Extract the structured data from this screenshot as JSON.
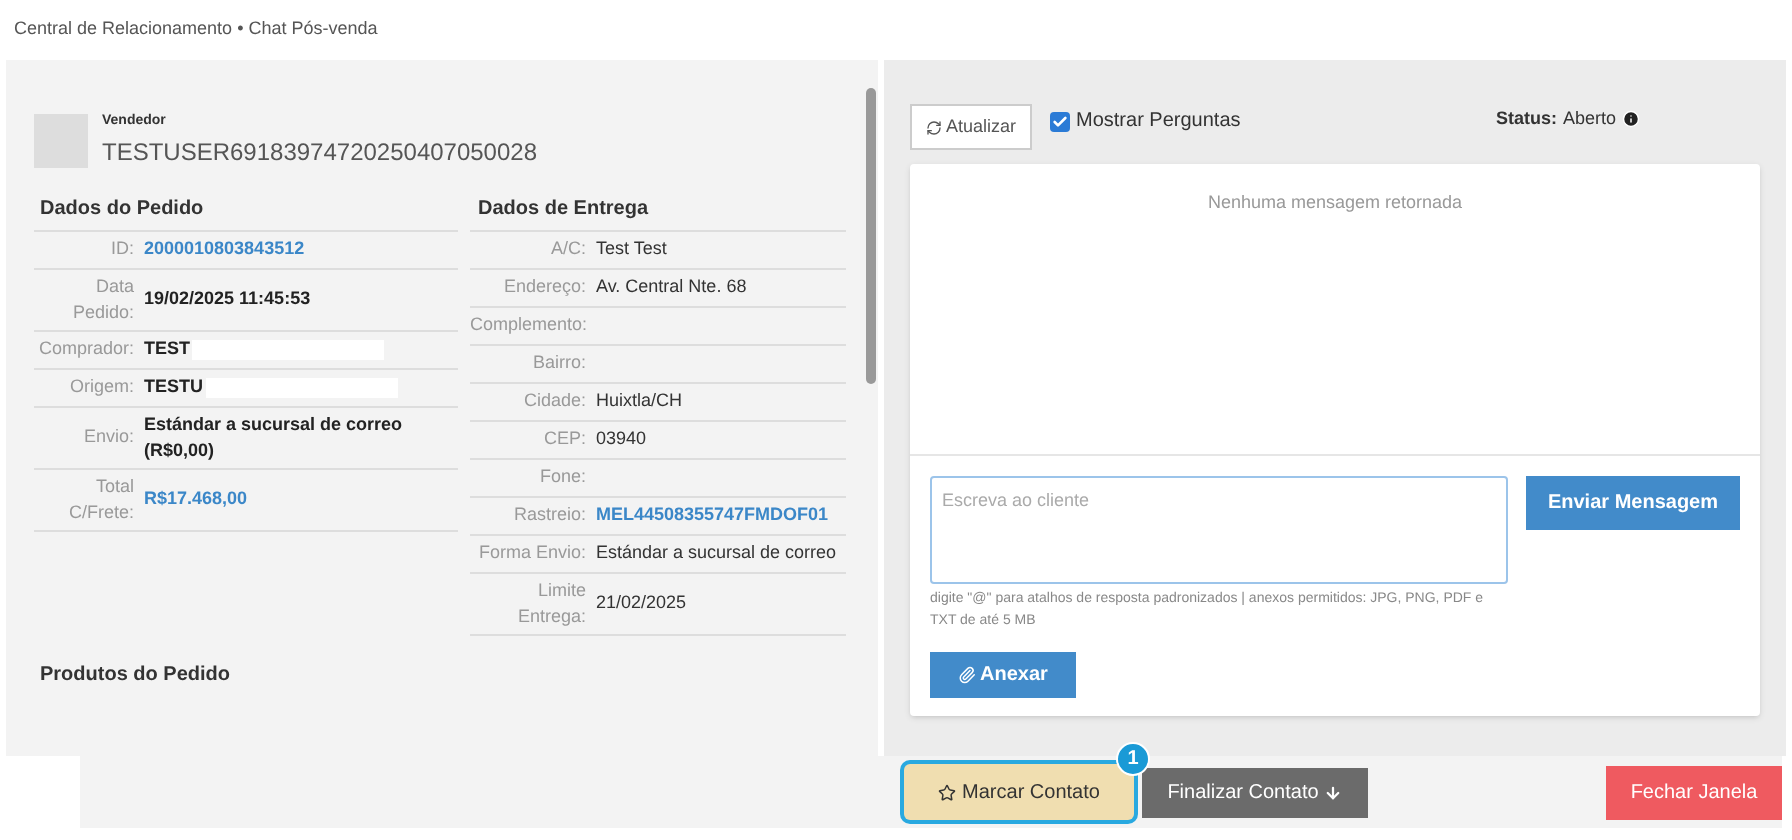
{
  "breadcrumb": "Central de Relacionamento • Chat Pós-venda",
  "seller": {
    "label": "Vendedor",
    "name": "TESTUSER69183974720250407050028"
  },
  "order": {
    "title": "Dados do Pedido",
    "rows": [
      {
        "label": "ID:",
        "value": "2000010803843512",
        "kind": "link",
        "redacted": false
      },
      {
        "label": "Data Pedido:",
        "value": "19/02/2025 11:45:53",
        "kind": "bold",
        "redacted": false
      },
      {
        "label": "Comprador:",
        "value": "TEST",
        "kind": "bold",
        "redacted": true
      },
      {
        "label": "Origem:",
        "value": "TESTU",
        "kind": "bold",
        "redacted": true
      },
      {
        "label": "Envio:",
        "value": "Estándar a sucursal de correo (R$0,00)",
        "kind": "bold",
        "redacted": false
      },
      {
        "label": "Total C/Frete:",
        "value": "R$17.468,00",
        "kind": "link",
        "redacted": false
      }
    ]
  },
  "delivery": {
    "title": "Dados de Entrega",
    "rows": [
      {
        "label": "A/C:",
        "value": "Test Test",
        "kind": "plain"
      },
      {
        "label": "Endereço:",
        "value": "Av. Central Nte. 68",
        "kind": "plain"
      },
      {
        "label": "Complemento:"
      },
      {
        "label": "Bairro:"
      },
      {
        "label": "Cidade:",
        "value": "Huixtla/CH",
        "kind": "plain"
      },
      {
        "label": "CEP:",
        "value": "03940",
        "kind": "plain"
      },
      {
        "label": "Fone:"
      },
      {
        "label": "Rastreio:",
        "value": "MEL44508355747FMDOF01",
        "kind": "link"
      },
      {
        "label": "Forma Envio:",
        "value": "Estándar a sucursal de correo",
        "kind": "plain"
      },
      {
        "label": "Limite Entrega:",
        "value": "21/02/2025",
        "kind": "plain"
      }
    ]
  },
  "products_title": "Produtos do Pedido",
  "chat": {
    "refresh": "Atualizar",
    "show_questions": {
      "label": "Mostrar Perguntas",
      "checked": true
    },
    "status_label": "Status:",
    "status_value": "Aberto",
    "empty": "Nenhuma mensagem retornada",
    "placeholder": "Escreva ao cliente",
    "send": "Enviar Mensagem",
    "hint": "digite \"@\" para atalhos de resposta padronizados | anexos permitidos: JPG, PNG, PDF e TXT de até 5 MB",
    "attach": "Anexar"
  },
  "footer": {
    "mark": "Marcar Contato",
    "badge": "1",
    "finish": "Finalizar Contato",
    "close": "Fechar Janela"
  }
}
